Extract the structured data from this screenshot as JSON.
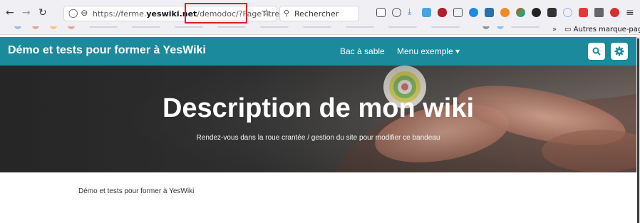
{
  "browser": {
    "url_prefix": "https://ferme.",
    "url_domain": "yeswiki.net",
    "url_path": "/demodoc/?PageTitre/",
    "search_placeholder": "Rechercher",
    "other_bookmarks_label": "Autres marque-pages",
    "bookmarks_chevron": "»"
  },
  "site": {
    "title": "Démo et tests pour former à YesWiki",
    "nav": [
      {
        "label": "Bac à sable"
      },
      {
        "label": "Menu exemple ▾"
      }
    ]
  },
  "hero": {
    "title": "Description de mon wiki",
    "subtitle": "Rendez-vous dans la roue crantée / gestion du site pour modifier ce bandeau"
  },
  "content": {
    "text": "Démo et tests pour former à YesWiki"
  },
  "colors": {
    "nav_bg": "#1a8a9c",
    "highlight": "#d8232a"
  }
}
